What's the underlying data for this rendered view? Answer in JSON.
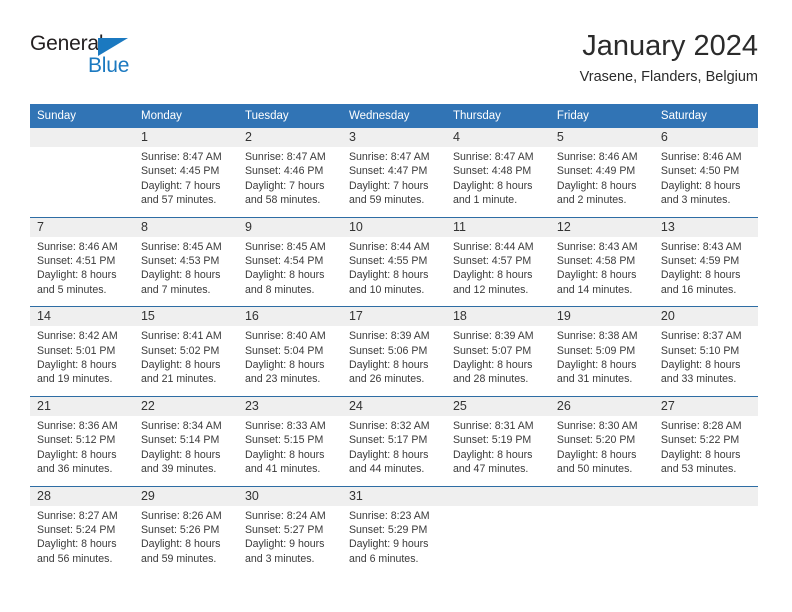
{
  "brand": {
    "name_top": "General",
    "name_bottom": "Blue",
    "triangle_color": "#1b79c0"
  },
  "header": {
    "title": "January 2024",
    "location": "Vrasene, Flanders, Belgium"
  },
  "theme": {
    "header_blue": "#3174b5",
    "row_rule_blue": "#2e6da4",
    "daynum_band": "#efefef",
    "text": "#333333"
  },
  "calendar": {
    "weekday_headers": [
      "Sunday",
      "Monday",
      "Tuesday",
      "Wednesday",
      "Thursday",
      "Friday",
      "Saturday"
    ],
    "weeks": [
      [
        {
          "day": "",
          "sunrise": "",
          "sunset": "",
          "daylight_line1": "",
          "daylight_line2": ""
        },
        {
          "day": "1",
          "sunrise": "Sunrise: 8:47 AM",
          "sunset": "Sunset: 4:45 PM",
          "daylight_line1": "Daylight: 7 hours",
          "daylight_line2": "and 57 minutes."
        },
        {
          "day": "2",
          "sunrise": "Sunrise: 8:47 AM",
          "sunset": "Sunset: 4:46 PM",
          "daylight_line1": "Daylight: 7 hours",
          "daylight_line2": "and 58 minutes."
        },
        {
          "day": "3",
          "sunrise": "Sunrise: 8:47 AM",
          "sunset": "Sunset: 4:47 PM",
          "daylight_line1": "Daylight: 7 hours",
          "daylight_line2": "and 59 minutes."
        },
        {
          "day": "4",
          "sunrise": "Sunrise: 8:47 AM",
          "sunset": "Sunset: 4:48 PM",
          "daylight_line1": "Daylight: 8 hours",
          "daylight_line2": "and 1 minute."
        },
        {
          "day": "5",
          "sunrise": "Sunrise: 8:46 AM",
          "sunset": "Sunset: 4:49 PM",
          "daylight_line1": "Daylight: 8 hours",
          "daylight_line2": "and 2 minutes."
        },
        {
          "day": "6",
          "sunrise": "Sunrise: 8:46 AM",
          "sunset": "Sunset: 4:50 PM",
          "daylight_line1": "Daylight: 8 hours",
          "daylight_line2": "and 3 minutes."
        }
      ],
      [
        {
          "day": "7",
          "sunrise": "Sunrise: 8:46 AM",
          "sunset": "Sunset: 4:51 PM",
          "daylight_line1": "Daylight: 8 hours",
          "daylight_line2": "and 5 minutes."
        },
        {
          "day": "8",
          "sunrise": "Sunrise: 8:45 AM",
          "sunset": "Sunset: 4:53 PM",
          "daylight_line1": "Daylight: 8 hours",
          "daylight_line2": "and 7 minutes."
        },
        {
          "day": "9",
          "sunrise": "Sunrise: 8:45 AM",
          "sunset": "Sunset: 4:54 PM",
          "daylight_line1": "Daylight: 8 hours",
          "daylight_line2": "and 8 minutes."
        },
        {
          "day": "10",
          "sunrise": "Sunrise: 8:44 AM",
          "sunset": "Sunset: 4:55 PM",
          "daylight_line1": "Daylight: 8 hours",
          "daylight_line2": "and 10 minutes."
        },
        {
          "day": "11",
          "sunrise": "Sunrise: 8:44 AM",
          "sunset": "Sunset: 4:57 PM",
          "daylight_line1": "Daylight: 8 hours",
          "daylight_line2": "and 12 minutes."
        },
        {
          "day": "12",
          "sunrise": "Sunrise: 8:43 AM",
          "sunset": "Sunset: 4:58 PM",
          "daylight_line1": "Daylight: 8 hours",
          "daylight_line2": "and 14 minutes."
        },
        {
          "day": "13",
          "sunrise": "Sunrise: 8:43 AM",
          "sunset": "Sunset: 4:59 PM",
          "daylight_line1": "Daylight: 8 hours",
          "daylight_line2": "and 16 minutes."
        }
      ],
      [
        {
          "day": "14",
          "sunrise": "Sunrise: 8:42 AM",
          "sunset": "Sunset: 5:01 PM",
          "daylight_line1": "Daylight: 8 hours",
          "daylight_line2": "and 19 minutes."
        },
        {
          "day": "15",
          "sunrise": "Sunrise: 8:41 AM",
          "sunset": "Sunset: 5:02 PM",
          "daylight_line1": "Daylight: 8 hours",
          "daylight_line2": "and 21 minutes."
        },
        {
          "day": "16",
          "sunrise": "Sunrise: 8:40 AM",
          "sunset": "Sunset: 5:04 PM",
          "daylight_line1": "Daylight: 8 hours",
          "daylight_line2": "and 23 minutes."
        },
        {
          "day": "17",
          "sunrise": "Sunrise: 8:39 AM",
          "sunset": "Sunset: 5:06 PM",
          "daylight_line1": "Daylight: 8 hours",
          "daylight_line2": "and 26 minutes."
        },
        {
          "day": "18",
          "sunrise": "Sunrise: 8:39 AM",
          "sunset": "Sunset: 5:07 PM",
          "daylight_line1": "Daylight: 8 hours",
          "daylight_line2": "and 28 minutes."
        },
        {
          "day": "19",
          "sunrise": "Sunrise: 8:38 AM",
          "sunset": "Sunset: 5:09 PM",
          "daylight_line1": "Daylight: 8 hours",
          "daylight_line2": "and 31 minutes."
        },
        {
          "day": "20",
          "sunrise": "Sunrise: 8:37 AM",
          "sunset": "Sunset: 5:10 PM",
          "daylight_line1": "Daylight: 8 hours",
          "daylight_line2": "and 33 minutes."
        }
      ],
      [
        {
          "day": "21",
          "sunrise": "Sunrise: 8:36 AM",
          "sunset": "Sunset: 5:12 PM",
          "daylight_line1": "Daylight: 8 hours",
          "daylight_line2": "and 36 minutes."
        },
        {
          "day": "22",
          "sunrise": "Sunrise: 8:34 AM",
          "sunset": "Sunset: 5:14 PM",
          "daylight_line1": "Daylight: 8 hours",
          "daylight_line2": "and 39 minutes."
        },
        {
          "day": "23",
          "sunrise": "Sunrise: 8:33 AM",
          "sunset": "Sunset: 5:15 PM",
          "daylight_line1": "Daylight: 8 hours",
          "daylight_line2": "and 41 minutes."
        },
        {
          "day": "24",
          "sunrise": "Sunrise: 8:32 AM",
          "sunset": "Sunset: 5:17 PM",
          "daylight_line1": "Daylight: 8 hours",
          "daylight_line2": "and 44 minutes."
        },
        {
          "day": "25",
          "sunrise": "Sunrise: 8:31 AM",
          "sunset": "Sunset: 5:19 PM",
          "daylight_line1": "Daylight: 8 hours",
          "daylight_line2": "and 47 minutes."
        },
        {
          "day": "26",
          "sunrise": "Sunrise: 8:30 AM",
          "sunset": "Sunset: 5:20 PM",
          "daylight_line1": "Daylight: 8 hours",
          "daylight_line2": "and 50 minutes."
        },
        {
          "day": "27",
          "sunrise": "Sunrise: 8:28 AM",
          "sunset": "Sunset: 5:22 PM",
          "daylight_line1": "Daylight: 8 hours",
          "daylight_line2": "and 53 minutes."
        }
      ],
      [
        {
          "day": "28",
          "sunrise": "Sunrise: 8:27 AM",
          "sunset": "Sunset: 5:24 PM",
          "daylight_line1": "Daylight: 8 hours",
          "daylight_line2": "and 56 minutes."
        },
        {
          "day": "29",
          "sunrise": "Sunrise: 8:26 AM",
          "sunset": "Sunset: 5:26 PM",
          "daylight_line1": "Daylight: 8 hours",
          "daylight_line2": "and 59 minutes."
        },
        {
          "day": "30",
          "sunrise": "Sunrise: 8:24 AM",
          "sunset": "Sunset: 5:27 PM",
          "daylight_line1": "Daylight: 9 hours",
          "daylight_line2": "and 3 minutes."
        },
        {
          "day": "31",
          "sunrise": "Sunrise: 8:23 AM",
          "sunset": "Sunset: 5:29 PM",
          "daylight_line1": "Daylight: 9 hours",
          "daylight_line2": "and 6 minutes."
        },
        {
          "day": "",
          "sunrise": "",
          "sunset": "",
          "daylight_line1": "",
          "daylight_line2": ""
        },
        {
          "day": "",
          "sunrise": "",
          "sunset": "",
          "daylight_line1": "",
          "daylight_line2": ""
        },
        {
          "day": "",
          "sunrise": "",
          "sunset": "",
          "daylight_line1": "",
          "daylight_line2": ""
        }
      ]
    ]
  }
}
